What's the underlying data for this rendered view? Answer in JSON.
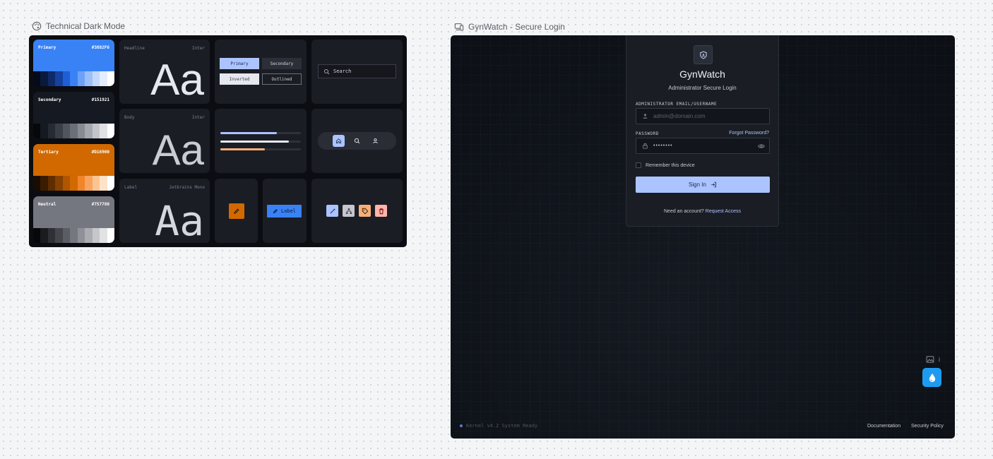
{
  "left_frame": {
    "title": "Technical Dark Mode",
    "swatches": [
      {
        "name": "Primary",
        "hex": "#3882F6",
        "color": "#3882f6",
        "text_color": "#ffffff",
        "strip": [
          "#050b1c",
          "#0a1a3d",
          "#0f2a66",
          "#1541a0",
          "#1f5fd6",
          "#3882f6",
          "#6ea2f8",
          "#9bbffa",
          "#c4d8fc",
          "#e3edfe",
          "#ffffff"
        ]
      },
      {
        "name": "Secondary",
        "hex": "#151921",
        "color": "#151921",
        "text_color": "#ffffff",
        "strip": [
          "#06080b",
          "#151921",
          "#262a31",
          "#3a3e46",
          "#51555d",
          "#6b6f77",
          "#888b92",
          "#a5a8ae",
          "#c3c5ca",
          "#e0e2e5",
          "#ffffff"
        ]
      },
      {
        "name": "Tertiary",
        "hex": "#D16900",
        "color": "#d16900",
        "text_color": "#ffffff",
        "strip": [
          "#1a0c00",
          "#3b1c00",
          "#5e2d00",
          "#864000",
          "#b05500",
          "#d16900",
          "#f0852a",
          "#f8a45f",
          "#fbc493",
          "#fde2c8",
          "#ffffff"
        ]
      },
      {
        "name": "Neutral",
        "hex": "#757780",
        "color": "#757780",
        "text_color": "#ffffff",
        "strip": [
          "#07080a",
          "#1a1b1f",
          "#2e3035",
          "#44464c",
          "#5b5d64",
          "#757780",
          "#8f9199",
          "#aaacb2",
          "#c5c7cb",
          "#e1e2e4",
          "#ffffff"
        ]
      }
    ],
    "typography": [
      {
        "role": "Headline",
        "font": "Inter",
        "sample": "Aa"
      },
      {
        "role": "Body",
        "font": "Inter",
        "sample": "Aa"
      },
      {
        "role": "Label",
        "font": "Jetbrains Mono",
        "sample": "Aa"
      }
    ],
    "buttons": {
      "primary": "Primary",
      "secondary": "Secondary",
      "inverted": "Inverted",
      "outlined": "Outlined"
    },
    "progress": [
      {
        "color": "#abc4ff",
        "fraction": 0.7
      },
      {
        "color": "#e6e8ee",
        "fraction": 0.85
      },
      {
        "color": "#f8b07a",
        "fraction": 0.55
      }
    ],
    "search_placeholder": "Search",
    "nav_icons": [
      "home-icon",
      "search-icon",
      "person-icon"
    ],
    "fab_label": "Label",
    "chip_icons": [
      "magic-wand-icon",
      "hierarchy-icon",
      "tag-icon",
      "trash-icon"
    ]
  },
  "right_frame": {
    "title": "GynWatch - Secure Login",
    "brand": "GynWatch",
    "subtitle": "Administrator Secure Login",
    "email": {
      "label": "ADMINISTRATOR EMAIL/USERNAME",
      "placeholder": "admin@domain.com"
    },
    "password": {
      "label": "PASSWORD",
      "value": "••••••••",
      "forgot": "Forgot Password?"
    },
    "remember": "Remember this device",
    "signin": "Sign In",
    "signup_prompt": "Need an account?",
    "signup_link": "Request Access",
    "status": "Kernel v4.2 System Ready",
    "footer_links": [
      "Documentation",
      "Security Policy"
    ],
    "info_glyph": "i"
  },
  "colors": {
    "accent": "#abc4ff",
    "canvas": "#0b0d12",
    "card": "#1b1d24",
    "tertiary": "#d16900"
  }
}
